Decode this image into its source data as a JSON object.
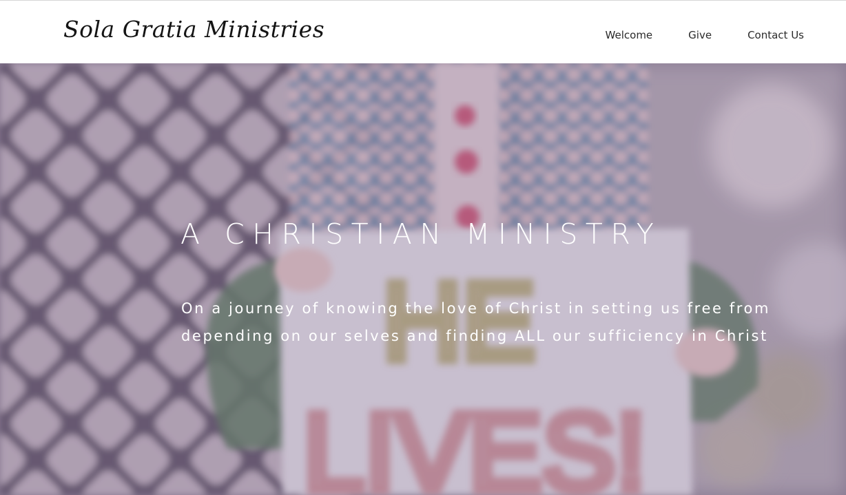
{
  "header": {
    "logo": "Sola Gratia Ministries",
    "nav": [
      {
        "label": "Welcome"
      },
      {
        "label": "Give"
      },
      {
        "label": "Contact Us"
      }
    ]
  },
  "hero": {
    "title": "A CHRISTIAN MINISTRY",
    "subtitle_lines": [
      "On a journey of knowing the love of Christ in setting us free from",
      "depending on our selves and finding ALL our sufficiency in Christ"
    ],
    "sign_text": [
      "HE",
      "LIVES!"
    ]
  },
  "colors": {
    "header_bg": "#ffffff",
    "logo_text": "#141414",
    "nav_text": "#2a2a2a",
    "hero_overlay": "#766886",
    "hero_text": "#ffffff",
    "button_pink": "#cf5478",
    "dress_blue": "#7fa3c4",
    "sleeve_green": "#6f8a6a"
  },
  "icons": {
    "background_image": "child-holding-he-lives-sign-photo"
  }
}
